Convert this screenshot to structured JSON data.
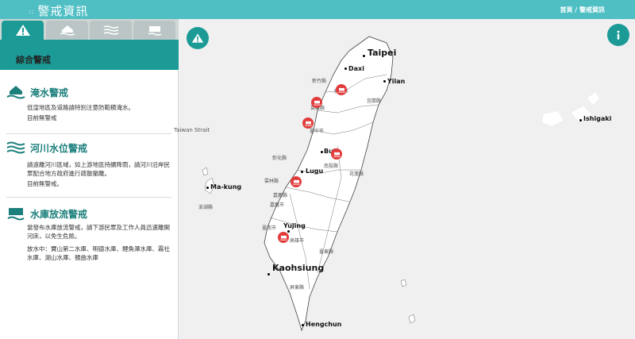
{
  "header": {
    "brand": "警戒資訊",
    "brand_dots": "::",
    "breadcrumb_home": "首頁",
    "breadcrumb_sep": "/",
    "breadcrumb_current": "警戒資訊"
  },
  "tabs": [
    {
      "icon": "warning-icon"
    },
    {
      "icon": "flood-house-icon"
    },
    {
      "icon": "river-waves-icon"
    },
    {
      "icon": "dam-icon"
    }
  ],
  "sidebar": {
    "title": "綜合警戒",
    "sections": [
      {
        "icon": "flood-house-icon",
        "title": "淹水警戒",
        "desc": "低窪地區及道路請特別注意防範積淹水。",
        "status": "目前無警戒"
      },
      {
        "icon": "river-waves-icon",
        "title": "河川水位警戒",
        "desc": "請遠離河川區域，如上游地區持續降雨，請河川沿岸民眾配合地方政府進行疏散撤離。",
        "status": "目前無警戒。"
      },
      {
        "icon": "dam-icon",
        "title": "水庫放流警戒",
        "desc": "當發布水庫放流警戒，請下游民眾及工作人員迅速離開河床，以免生危險。",
        "status": "放水中：寶山第二水庫、明德水庫、鯉魚潭水庫、霧社水庫、湖山水庫、親曲水庫"
      }
    ]
  },
  "map": {
    "cities": [
      "Taipei",
      "Daxi",
      "Yilan",
      "Buli",
      "Lugu",
      "Ma-kung",
      "Yujing",
      "Kaohsiung",
      "Hengchun",
      "Ishigaki"
    ],
    "counties": [
      "新竹縣",
      "新竹市",
      "苗栗縣",
      "臺中市",
      "南投縣",
      "花蓮縣",
      "彰化縣",
      "雲林縣",
      "嘉義縣",
      "嘉義市",
      "臺南市",
      "高雄市",
      "屏東縣",
      "臺東縣",
      "宜蘭縣",
      "澎湖縣"
    ],
    "strait_label": "Taiwan Strait",
    "colors": {
      "header": "#4fbfc4",
      "accent": "#1b9a96",
      "marker": "#e23b3b",
      "land": "#ffffff",
      "sea": "#f0f0f0"
    }
  }
}
